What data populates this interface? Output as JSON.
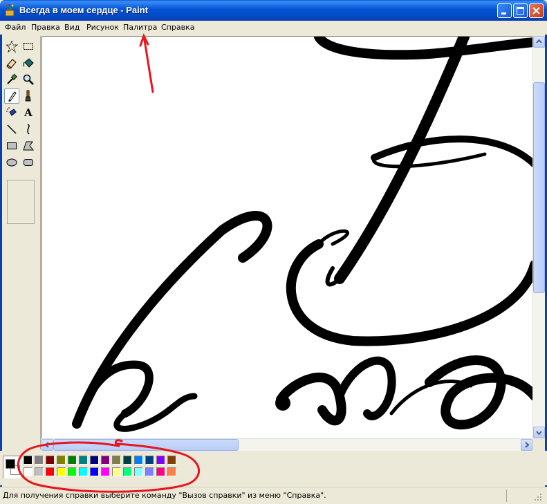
{
  "window": {
    "title": "Всегда в моем сердце - Paint",
    "controls": [
      "minimize",
      "maximize",
      "close"
    ]
  },
  "menu": {
    "items": [
      "Файл",
      "Правка",
      "Вид",
      "Рисунок",
      "Палитра",
      "Справка"
    ]
  },
  "toolbox": {
    "tools": [
      {
        "name": "free-form-select",
        "icon": "star-select-icon"
      },
      {
        "name": "rect-select",
        "icon": "dashed-rect-icon"
      },
      {
        "name": "eraser",
        "icon": "eraser-icon"
      },
      {
        "name": "fill",
        "icon": "paint-bucket-icon"
      },
      {
        "name": "pick-color",
        "icon": "eyedropper-icon"
      },
      {
        "name": "magnifier",
        "icon": "magnifier-icon"
      },
      {
        "name": "pencil",
        "icon": "pencil-icon",
        "selected": true
      },
      {
        "name": "brush",
        "icon": "brush-icon"
      },
      {
        "name": "airbrush",
        "icon": "airbrush-icon"
      },
      {
        "name": "text",
        "icon": "text-icon",
        "label": "A"
      },
      {
        "name": "line",
        "icon": "line-icon"
      },
      {
        "name": "curve",
        "icon": "curve-icon"
      },
      {
        "name": "rectangle",
        "icon": "rectangle-icon"
      },
      {
        "name": "polygon",
        "icon": "polygon-icon"
      },
      {
        "name": "ellipse",
        "icon": "ellipse-icon"
      },
      {
        "name": "rounded-rectangle",
        "icon": "rounded-rect-icon"
      }
    ]
  },
  "palette": {
    "foreground": "#000000",
    "background": "#ffffff",
    "row1": [
      "#000000",
      "#808080",
      "#800000",
      "#808000",
      "#008000",
      "#008080",
      "#000080",
      "#800080",
      "#808040",
      "#004040",
      "#0080ff",
      "#004080",
      "#8000ff",
      "#804000"
    ],
    "row2": [
      "#ffffff",
      "#c0c0c0",
      "#ff0000",
      "#ffff00",
      "#00ff00",
      "#00ffff",
      "#0000ff",
      "#ff00ff",
      "#ffff80",
      "#00ff80",
      "#80ffff",
      "#8080ff",
      "#ff0080",
      "#ff8040"
    ]
  },
  "annotations": {
    "arrow_color": "#e8151b",
    "circle_color": "#e8151b"
  },
  "statusbar": {
    "text": "Для получения справки выберите команду \"Вызов справки\" из меню \"Справка\"."
  }
}
